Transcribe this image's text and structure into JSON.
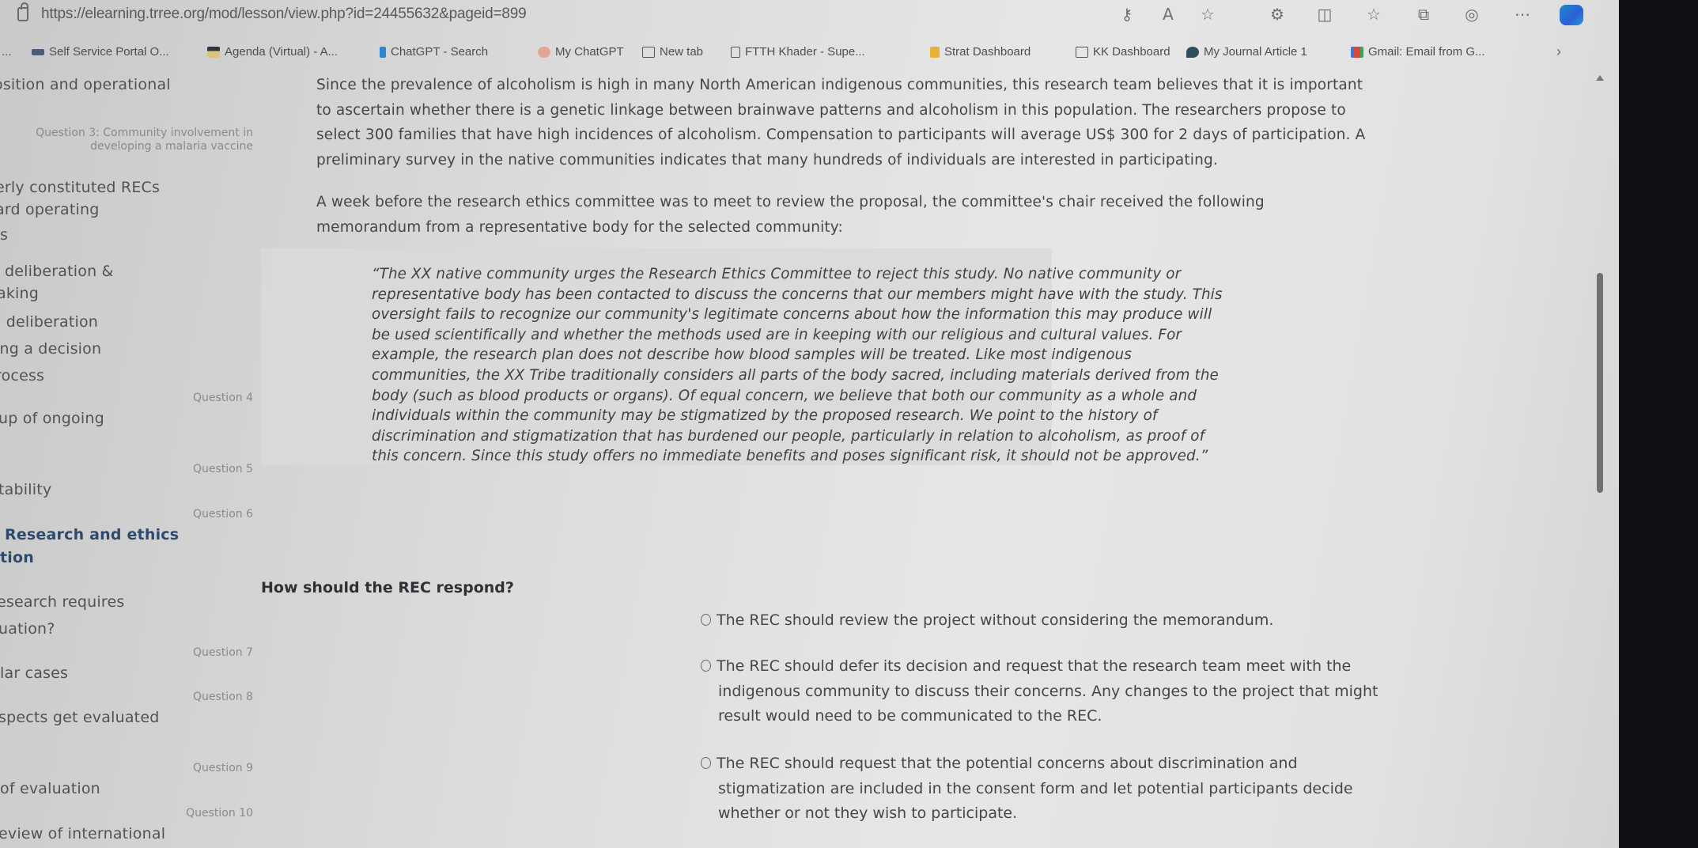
{
  "browser": {
    "url": "https://elearning.trree.org/mod/lesson/view.php?id=24455632&pageid=899",
    "toolbar_icons": [
      "key-icon",
      "read-aloud-icon",
      "favorite-star-icon",
      "extensions-icon",
      "split-screen-icon",
      "favorites-list-icon",
      "collections-icon",
      "profile-icon",
      "more-menu-icon",
      "copilot-icon"
    ],
    "bookmarks": [
      {
        "label": "...",
        "icon": "truncated"
      },
      {
        "label": "Self Service Portal O...",
        "icon": "portal-icon"
      },
      {
        "label": "Agenda (Virtual) - A...",
        "icon": "agenda-icon"
      },
      {
        "label": "ChatGPT - Search",
        "icon": "bing-icon"
      },
      {
        "label": "My ChatGPT",
        "icon": "chatgpt-icon"
      },
      {
        "label": "New tab",
        "icon": "newtab-icon"
      },
      {
        "label": "FTTH Khader - Supe...",
        "icon": "document-icon"
      },
      {
        "label": "Strat Dashboard",
        "icon": "chart-icon"
      },
      {
        "label": "KK Dashboard",
        "icon": "newtab-icon"
      },
      {
        "label": "My Journal Article 1",
        "icon": "journal-icon"
      },
      {
        "label": "Gmail: Email from G...",
        "icon": "gmail-icon"
      }
    ],
    "more_bookmarks_glyph": "›"
  },
  "nav": {
    "items": [
      {
        "text": "osition and operational",
        "kind": "link"
      },
      {
        "text": "Question 3: Community involvement in developing a malaria vaccine",
        "kind": "question"
      },
      {
        "text": "erly constituted RECs",
        "kind": "link"
      },
      {
        "text": "ard operating",
        "kind": "link"
      },
      {
        "text": "s",
        "kind": "link"
      },
      {
        "text": "deliberation &",
        "kind": "link"
      },
      {
        "text": "aking",
        "kind": "link"
      },
      {
        "text": "l deliberation",
        "kind": "link"
      },
      {
        "text": "ing a decision",
        "kind": "link"
      },
      {
        "text": "rocess",
        "kind": "link"
      },
      {
        "text": "Question 4",
        "kind": "question"
      },
      {
        "text": "up of ongoing",
        "kind": "link"
      },
      {
        "text": "Question 5",
        "kind": "question"
      },
      {
        "text": "tability",
        "kind": "link"
      },
      {
        "text": "Question 6",
        "kind": "question"
      },
      {
        "text": "Research and ethics",
        "kind": "current"
      },
      {
        "text": "tion",
        "kind": "current"
      },
      {
        "text": "esearch requires",
        "kind": "link"
      },
      {
        "text": "uation?",
        "kind": "link"
      },
      {
        "text": "Question 7",
        "kind": "question"
      },
      {
        "text": "lar cases",
        "kind": "link"
      },
      {
        "text": "Question 8",
        "kind": "question"
      },
      {
        "text": "spects get evaluated",
        "kind": "link"
      },
      {
        "text": "Question 9",
        "kind": "question"
      },
      {
        "text": "of evaluation",
        "kind": "link"
      },
      {
        "text": "Question 10",
        "kind": "question"
      },
      {
        "text": "eview of international",
        "kind": "link"
      }
    ]
  },
  "content": {
    "intro_lines": [
      "Since the prevalence of alcoholism is high in many North American indigenous communities, this research team believes that it is important",
      "to ascertain whether there is a genetic linkage between brainwave patterns and alcoholism in this population. The researchers propose to",
      "select 300 families that have high incidences of alcoholism. Compensation to participants will average US$ 300 for 2 days of participation. A",
      "preliminary survey in the native communities indicates that many hundreds of individuals are interested in participating."
    ],
    "memo_intro_lines": [
      "A week before the research ethics committee was to meet to review the proposal, the committee's chair received the following",
      "memorandum from a representative body for the selected community:"
    ],
    "memo_lines": [
      "“The XX native community urges the Research Ethics Committee to reject this study. No native community or",
      "representative body has been contacted to discuss the concerns that our members might have with the study. This",
      "oversight fails to recognize our community's legitimate concerns about how the information this may produce will",
      "be used scientifically and whether the methods used are in keeping with our religious and cultural values. For",
      "example, the research plan does not describe how blood samples will be treated. Like most indigenous",
      "communities, the XX Tribe traditionally considers all parts of the body sacred, including materials derived from the",
      "body (such as blood products or organs). Of equal concern, we believe that both our community as a whole and",
      "individuals within the community may be stigmatized by the proposed research. We point to the history of",
      "discrimination and stigmatization that has burdened our people, particularly in relation to alcoholism, as proof of",
      "this concern. Since this study offers no immediate benefits and poses significant risk, it should not be approved.”"
    ],
    "question": "How should the REC respond?",
    "options": [
      {
        "lines": [
          "The REC should review the project without considering the memorandum."
        ],
        "selected": false
      },
      {
        "lines": [
          "The REC should defer its decision and request that the research team meet with the",
          "indigenous community to discuss their concerns. Any changes to the project that might",
          "result would need to be communicated to the REC."
        ],
        "selected": false
      },
      {
        "lines": [
          "The REC should request that the potential concerns about discrimination and",
          "stigmatization are included in the consent form and let potential participants decide",
          "whether or not they wish to participate."
        ],
        "selected": false
      }
    ]
  }
}
